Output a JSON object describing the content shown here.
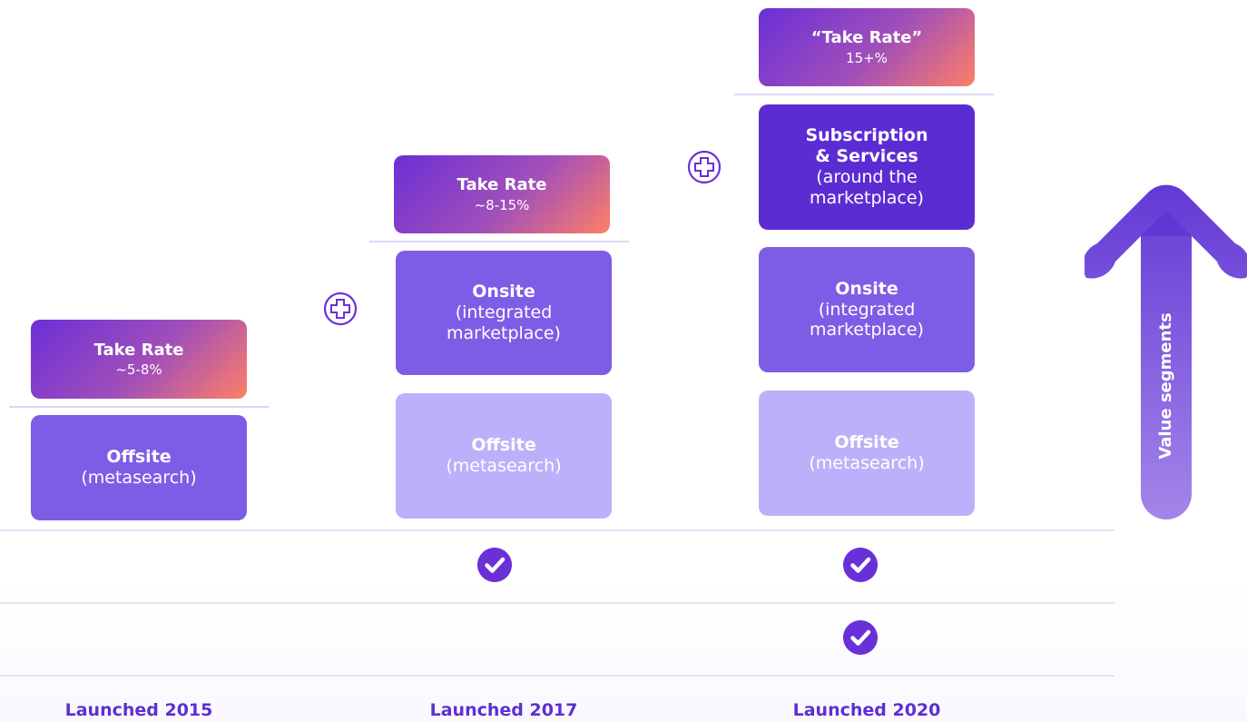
{
  "stages": [
    {
      "launch": "Launched 2015",
      "take_rate": {
        "title": "Take Rate",
        "value": "~5-8%"
      },
      "offsite": {
        "title": "Offsite",
        "sub": "(metasearch)"
      }
    },
    {
      "launch": "Launched 2017",
      "take_rate": {
        "title": "Take Rate",
        "value": "~8-15%"
      },
      "onsite": {
        "title": "Onsite",
        "sub1": "(integrated",
        "sub2": "marketplace)"
      },
      "offsite": {
        "title": "Offsite",
        "sub": "(metasearch)"
      }
    },
    {
      "launch": "Launched 2020",
      "take_rate": {
        "title": "“Take Rate”",
        "value": "15+%"
      },
      "subscription": {
        "title1": "Subscription",
        "title2": "& Services",
        "sub1": "(around the",
        "sub2": "marketplace)"
      },
      "onsite": {
        "title": "Onsite",
        "sub1": "(integrated",
        "sub2": "marketplace)"
      },
      "offsite": {
        "title": "Offsite",
        "sub": "(metasearch)"
      }
    }
  ],
  "arrow_label": "Value segments",
  "icons": {
    "plus": "plus-circle-icon",
    "check": "check-circle-icon",
    "arrow": "up-arrow-icon"
  },
  "colors": {
    "accent": "#5d2fd4",
    "mid": "#7e5de6",
    "light": "#bdb0fb",
    "gradient_end": "#ff7f66"
  }
}
